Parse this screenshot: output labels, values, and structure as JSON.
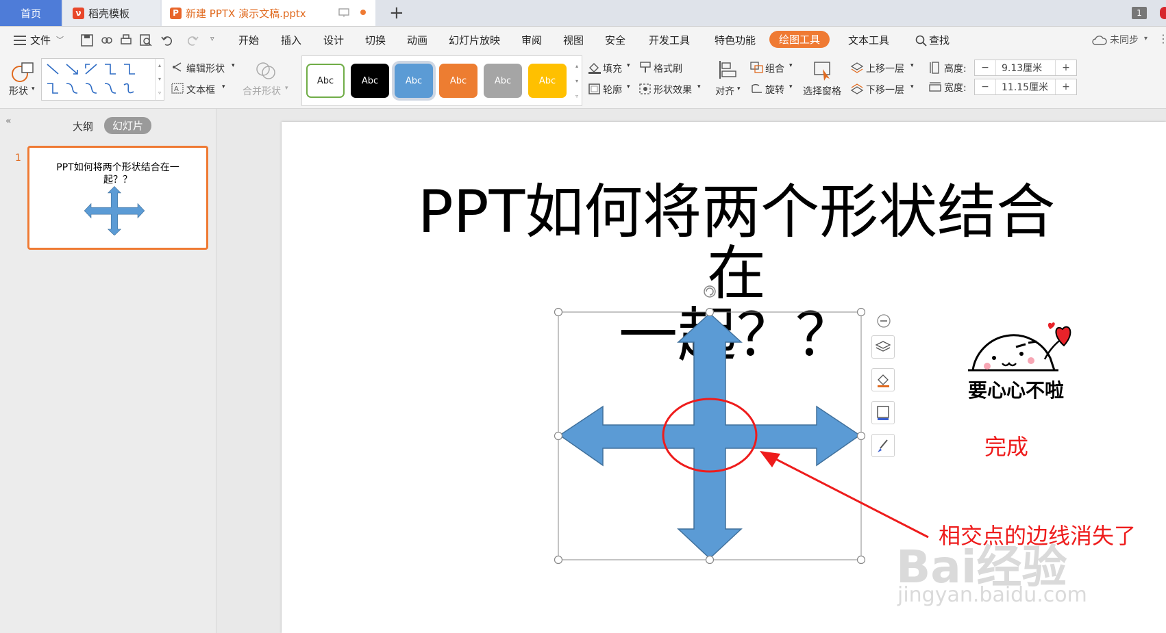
{
  "tabs": {
    "home": "首页",
    "templates": "稻壳模板",
    "document": "新建 PPTX 演示文稿.pptx",
    "add": "+",
    "window_count": "1"
  },
  "menu": {
    "file": "文件",
    "items": [
      "开始",
      "插入",
      "设计",
      "切换",
      "动画",
      "幻灯片放映",
      "审阅",
      "视图",
      "安全",
      "开发工具",
      "特色功能",
      "绘图工具",
      "文本工具"
    ],
    "active": "绘图工具",
    "search": "查找",
    "sync": "未同步"
  },
  "ribbon": {
    "shapes": "形状",
    "edit_shape": "编辑形状",
    "text_box": "文本框",
    "merge_shape": "合并形状",
    "style_sample": "Abc",
    "fill": "填充",
    "format_painter": "格式刷",
    "outline": "轮廓",
    "shape_effects": "形状效果",
    "align": "对齐",
    "group": "组合",
    "rotate": "旋转",
    "selection_pane": "选择窗格",
    "bring_forward": "上移一层",
    "send_backward": "下移一层",
    "height_label": "高度:",
    "height_value": "9.13厘米",
    "width_label": "宽度:",
    "width_value": "11.15厘米",
    "minus": "−",
    "plus": "+"
  },
  "colors": {
    "accent": "#ef7a33",
    "shape_blue": "#5b9bd5",
    "annotation_red": "#ee1c1c",
    "style_boxes": [
      "#ffffff",
      "#000000",
      "#5b9bd5",
      "#ed7d31",
      "#a5a5a5",
      "#ffc000"
    ]
  },
  "left_panel": {
    "outline_tab": "大纲",
    "slides_tab": "幻灯片",
    "slide_number": "1",
    "thumb_title": "PPT如何将两个形状结合在一起？？"
  },
  "slide": {
    "title_line1": "PPT如何将两个形状结合在",
    "title_line2": "一起？？",
    "sticker_text": "要心心不啦",
    "done_text": "完成",
    "annotation": "相交点的边线消失了"
  },
  "watermark": {
    "brand": "Bai经验",
    "url": "jingyan.baidu.com"
  }
}
